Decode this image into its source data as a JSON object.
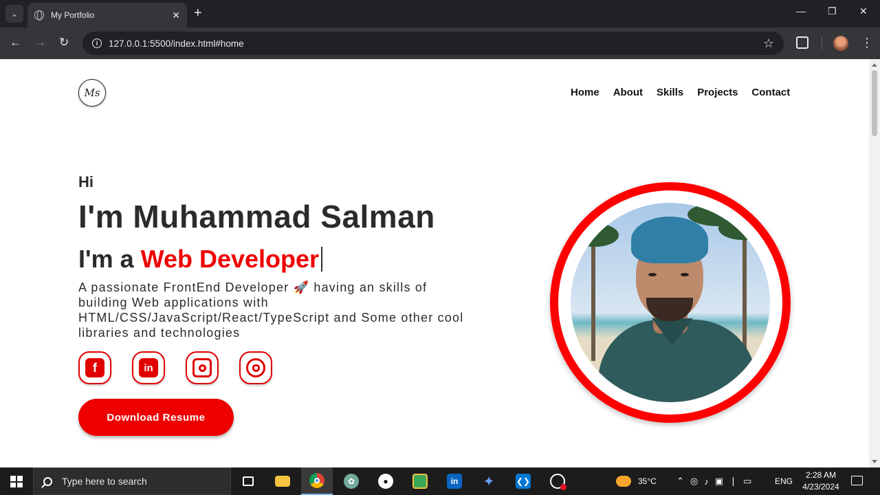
{
  "browser": {
    "tab_title": "My Portfolio",
    "tab_close": "✕",
    "new_tab": "+",
    "tab_search": "⌄",
    "url": "127.0.0.1:5500/index.html#home",
    "back": "←",
    "forward": "→",
    "reload": "↻",
    "bookmark": "☆",
    "menu": "⋮",
    "minimize": "—",
    "restore": "❐",
    "close": "✕"
  },
  "page": {
    "logo_text": "Ms",
    "nav": [
      "Home",
      "About",
      "Skills",
      "Projects",
      "Contact"
    ],
    "greeting": "Hi",
    "name": "I'm Muhammad Salman",
    "role_prefix": "I'm a ",
    "role_highlight": "Web Developer",
    "description": "A passionate FrontEnd Developer 🚀 having an skills of building Web applications with HTML/CSS/JavaScript/React/TypeScript and Some other cool libraries and technologies",
    "socials": [
      {
        "name": "facebook-icon",
        "glyph": "f"
      },
      {
        "name": "linkedin-icon",
        "glyph": "in"
      },
      {
        "name": "instagram-icon",
        "glyph": ""
      },
      {
        "name": "github-icon",
        "glyph": ""
      }
    ],
    "resume_button": "Download Resume",
    "accent_color": "#ee0000"
  },
  "taskbar": {
    "search_placeholder": "Type here to search",
    "weather": "35°C",
    "language": "ENG",
    "time": "2:28 AM",
    "date": "4/23/2024",
    "apps": [
      "task-view",
      "file-explorer",
      "chrome",
      "chatgpt",
      "github-desktop",
      "image-viewer",
      "linkedin",
      "gemini",
      "vscode",
      "clock-app"
    ]
  }
}
